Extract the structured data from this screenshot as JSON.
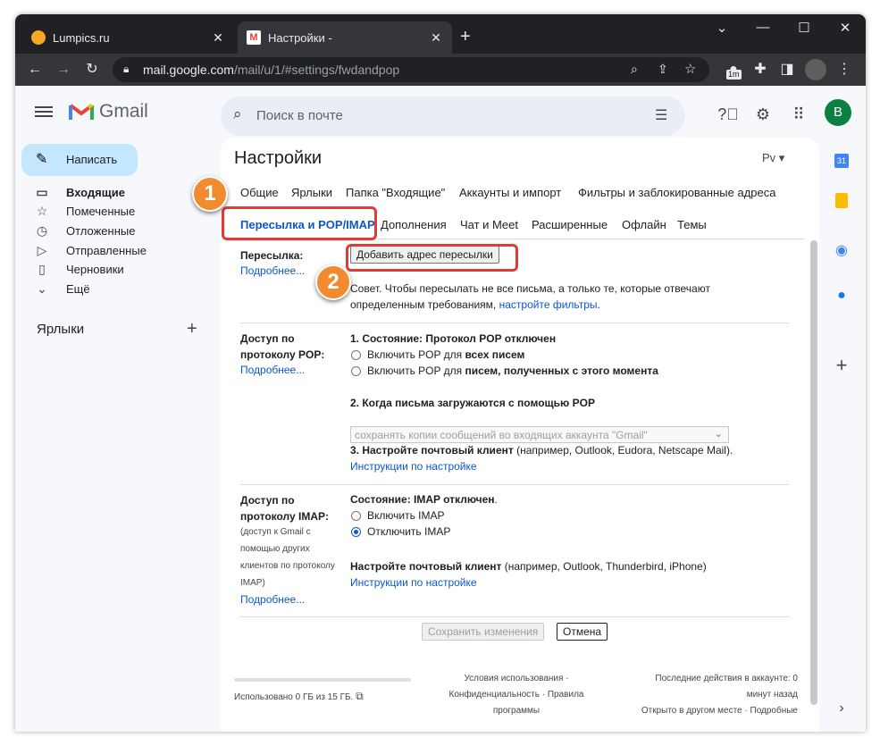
{
  "browser": {
    "tabs": [
      {
        "title": "Lumpics.ru",
        "close": "✕"
      },
      {
        "title": "Настройки - ",
        "close": "✕"
      }
    ],
    "new_tab": "+",
    "url_host": "mail.google.com",
    "url_path": "/mail/u/1/#settings/fwdandpop",
    "window_controls": {
      "minimize": "—",
      "maximize": "☐",
      "close": "✕",
      "tab_search": "⌄"
    },
    "ext_badge": "1m"
  },
  "gmail": {
    "brand": "Gmail",
    "search_placeholder": "Поиск в почте",
    "avatar_letter": "B",
    "compose_label": "Написать",
    "nav": [
      {
        "label": "Входящие",
        "icon": "inbox-icon",
        "glyph": "▭"
      },
      {
        "label": "Помеченные",
        "icon": "star-icon",
        "glyph": "☆"
      },
      {
        "label": "Отложенные",
        "icon": "clock-icon",
        "glyph": "◷"
      },
      {
        "label": "Отправленные",
        "icon": "send-icon",
        "glyph": "▷"
      },
      {
        "label": "Черновики",
        "icon": "draft-icon",
        "glyph": "▯"
      },
      {
        "label": "Ещё",
        "icon": "chevron-down-icon",
        "glyph": "⌄"
      }
    ],
    "labels_title": "Ярлыки"
  },
  "settings": {
    "title": "Настройки",
    "lang": "Рv",
    "tabs_row1": [
      "Общие",
      "Ярлыки",
      "Папка \"Входящие\"",
      "Аккаунты и импорт",
      "Фильтры и заблокированные адреса"
    ],
    "tabs_row2": [
      "Пересылка и POP/IMAP",
      "Дополнения",
      "Чат и Meet",
      "Расширенные",
      "Офлайн",
      "Темы"
    ],
    "forwarding": {
      "label": "Пересылка:",
      "more": "Подробнее...",
      "add_button": "Добавить адрес пересылки",
      "tip_1": "Совет. Чтобы пересылать не все письма, а только те, которые отвечают",
      "tip_2": "определенным требованиям,",
      "tip_link": "настройте фильтры",
      "tip_end": "."
    },
    "pop": {
      "label_1": "Доступ по",
      "label_2": "протоколу POP:",
      "more": "Подробнее...",
      "status": "1. Состояние: Протокол POP отключен",
      "opt1_pre": "Включить POP для",
      "opt1_bold": "всех писем",
      "opt2_pre": "Включить POP для",
      "opt2_bold": "писем, полученных с этого момента",
      "when_title": "2. Когда письма загружаются с помощью POP",
      "when_value": "сохранять копии сообщений во входящих аккаунта \"Gmail\"",
      "client_bold": "3. Настройте почтовый клиент",
      "client_rest": "(например, Outlook, Eudora, Netscape Mail).",
      "instructions": "Инструкции по настройке"
    },
    "imap": {
      "label_1": "Доступ по",
      "label_2": "протоколу IMAP:",
      "note_1": "(доступ к Gmail с",
      "note_2": "помощью других",
      "note_3": "клиентов по протоколу",
      "note_4": "IMAP)",
      "more": "Подробнее...",
      "status_bold": "Состояние: IMAP отключен",
      "status_end": ".",
      "opt_on": "Включить IMAP",
      "opt_off": "Отключить IMAP",
      "client_bold": "Настройте почтовый клиент",
      "client_rest": "(например, Outlook, Thunderbird, iPhone)",
      "instructions": "Инструкции по настройке"
    },
    "save": "Сохранить изменения",
    "cancel": "Отмена",
    "footer": {
      "usage": "Использовано 0 ГБ из 15 ГБ.",
      "terms_1": "Условия использования ·",
      "terms_2": "Конфиденциальность · Правила",
      "terms_3": "программы",
      "activity_1": "Последние действия в аккаунте: 0",
      "activity_2": "минут назад",
      "activity_3": "Открыто в другом месте · Подробные"
    }
  },
  "annotations": {
    "badge1": "1",
    "badge2": "2"
  },
  "colors": {
    "accent": "#0b57d0",
    "highlight": "#e53935",
    "badge": "#f28b30",
    "compose": "#c2e7ff"
  }
}
